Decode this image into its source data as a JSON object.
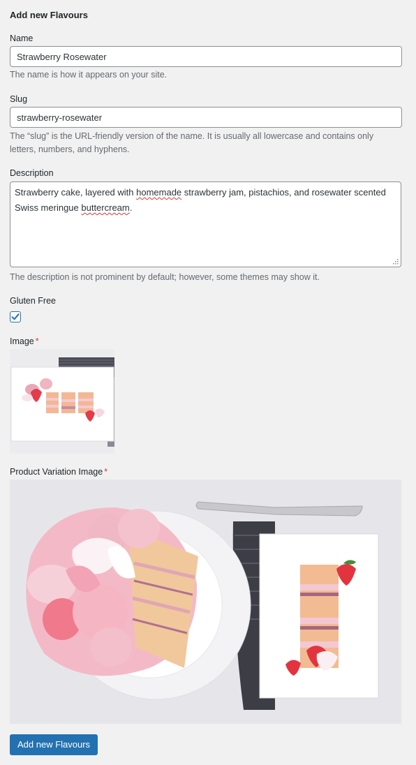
{
  "form": {
    "title": "Add new Flavours",
    "name": {
      "label": "Name",
      "value": "Strawberry Rosewater",
      "help": "The name is how it appears on your site."
    },
    "slug": {
      "label": "Slug",
      "value": "strawberry-rosewater",
      "help_line1": "The “slug” is the URL-friendly version of the name. It is usually all lowercase and contains only",
      "help_line2": "letters, numbers, and hyphens."
    },
    "description": {
      "label": "Description",
      "text_part1": "Strawberry cake, layered with ",
      "text_misspelled1": "homemade",
      "text_part2": " strawberry jam, pistachios, and rosewater scented Swiss meringue ",
      "text_misspelled2": "buttercream",
      "text_part3": ".",
      "help": "The description is not prominent by default; however, some themes may show it."
    },
    "gluten_free": {
      "label": "Gluten Free",
      "checked": true
    },
    "image": {
      "label": "Image",
      "required_mark": "*"
    },
    "variation_image": {
      "label": "Product Variation Image",
      "required_mark": "*"
    },
    "submit_label": "Add new Flavours"
  },
  "colors": {
    "primary": "#2271b1",
    "required": "#d63638",
    "help_text": "#646970",
    "background": "#f1f1f1"
  }
}
